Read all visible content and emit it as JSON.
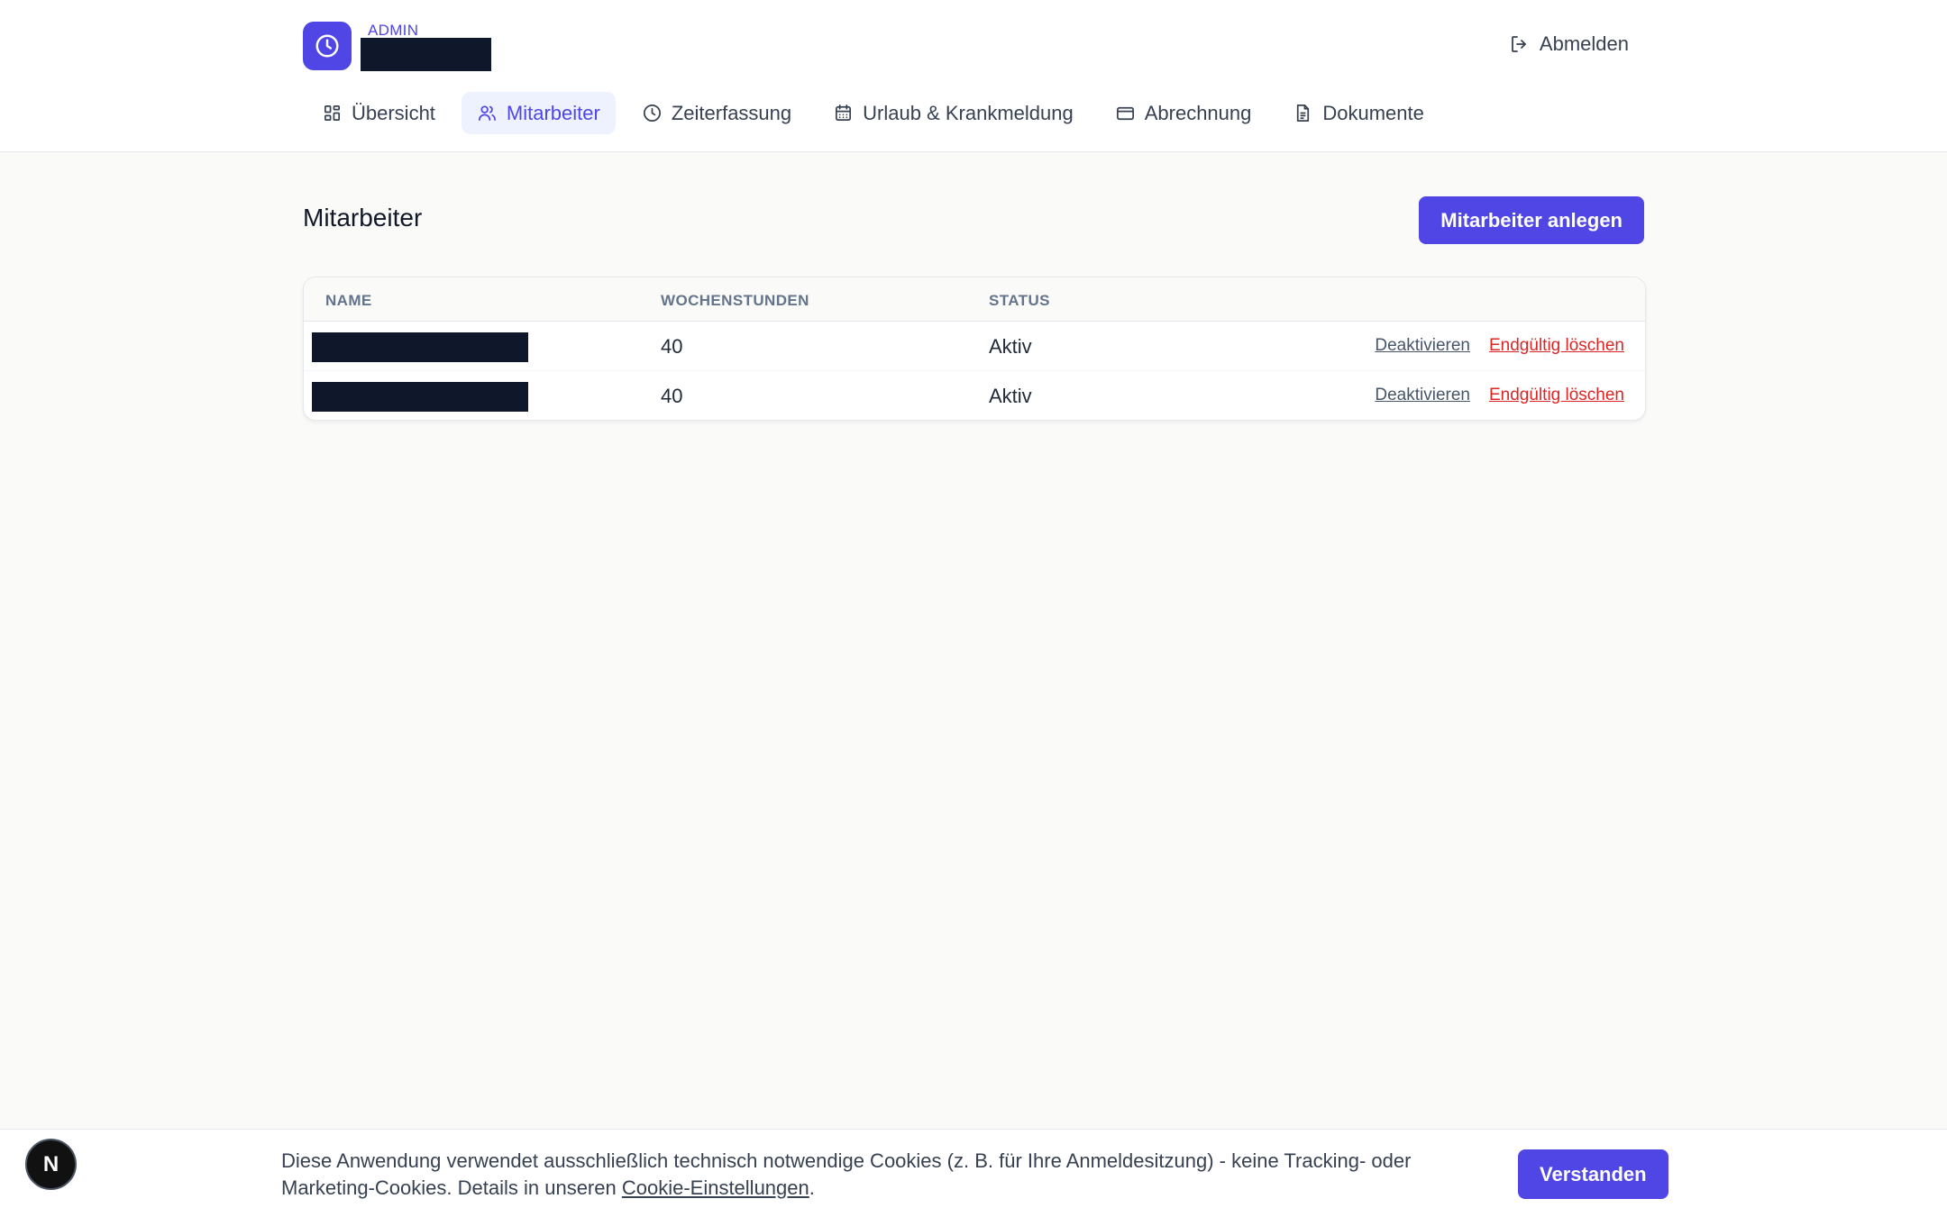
{
  "header": {
    "role_label": "ADMIN",
    "logout_label": "Abmelden"
  },
  "nav": {
    "items": [
      {
        "label": "Übersicht",
        "icon": "grid-icon"
      },
      {
        "label": "Mitarbeiter",
        "icon": "users-icon",
        "active": true
      },
      {
        "label": "Zeiterfassung",
        "icon": "clock-icon"
      },
      {
        "label": "Urlaub & Krankmeldung",
        "icon": "calendar-icon"
      },
      {
        "label": "Abrechnung",
        "icon": "credit-card-icon"
      },
      {
        "label": "Dokumente",
        "icon": "document-icon"
      }
    ]
  },
  "main": {
    "title": "Mitarbeiter",
    "create_button": "Mitarbeiter anlegen",
    "table": {
      "headers": [
        "NAME",
        "WOCHENSTUNDEN",
        "STATUS"
      ],
      "rows": [
        {
          "hours": "40",
          "status": "Aktiv",
          "deactivate": "Deaktivieren",
          "delete": "Endgültig löschen"
        },
        {
          "hours": "40",
          "status": "Aktiv",
          "deactivate": "Deaktivieren",
          "delete": "Endgültig löschen"
        }
      ]
    }
  },
  "cookie": {
    "text": "Diese Anwendung verwendet ausschließlich technisch notwendige Cookies (z. B. für Ihre Anmeldesitzung) - keine Tracking- oder Marketing-Cookies. Details in unseren ",
    "link": "Cookie-Einstellungen",
    "suffix": ".",
    "button": "Verstanden"
  },
  "badge": {
    "letter": "N"
  },
  "colors": {
    "accent": "#4f46e5",
    "danger": "#dc2626",
    "redaction": "#0f172a"
  }
}
